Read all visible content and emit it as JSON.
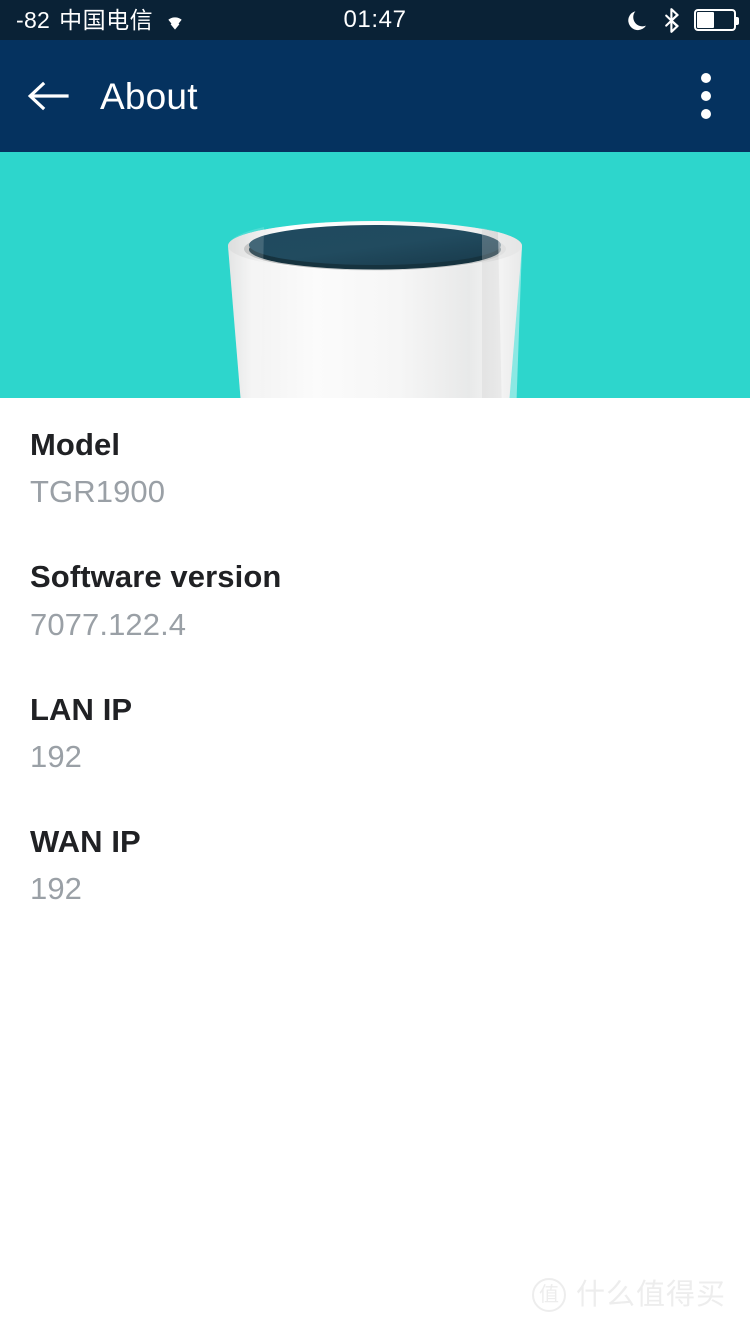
{
  "status_bar": {
    "rssi": "-82",
    "carrier": "中国电信",
    "wifi_icon": "wifi-icon",
    "clock": "01:47",
    "do_not_disturb_icon": "moon-icon",
    "bluetooth_icon": "bluetooth-icon",
    "battery_icon": "battery-icon",
    "battery_percent": 45,
    "background_color": "#0a2236"
  },
  "app_bar": {
    "back_icon": "arrow-left-icon",
    "title": "About",
    "overflow_icon": "more-vertical-icon",
    "background_color": "#05325f"
  },
  "hero": {
    "background_color": "#2dd6cc",
    "device_illustration": "wifi-router-illustration",
    "device_body_color": "#f2f2f2",
    "device_top_color": "#1e4659"
  },
  "info_list": [
    {
      "label": "Model",
      "value": "TGR1900"
    },
    {
      "label": "Software version",
      "value": "7077.122.4"
    },
    {
      "label": "LAN IP",
      "value": "192"
    },
    {
      "label": "WAN IP",
      "value": "192"
    }
  ],
  "watermark": {
    "badge": "值",
    "text": "什么值得买"
  }
}
